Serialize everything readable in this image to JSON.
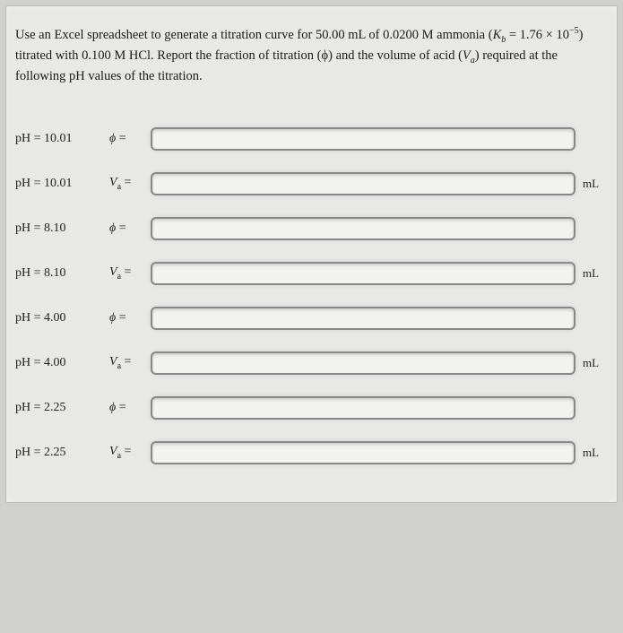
{
  "prompt": {
    "text_before_k": "Use an Excel spreadsheet to generate a titration curve for 50.00 mL of 0.0200 M ammonia (",
    "k_symbol": "K",
    "k_sub": "b",
    "k_eq": " = 1.76 × 10",
    "k_exp": "−5",
    "text_after_k": ") titrated with 0.100 M HCl. Report the fraction of titration (ϕ) and the volume of acid (",
    "va_prefix": "V",
    "va_sub": "a",
    "text_end": ") required at the following pH values of the titration."
  },
  "rows": [
    {
      "label": "pH = 10.01",
      "symbol_txt": "ϕ =",
      "symbol_html": "phi",
      "unit": ""
    },
    {
      "label": "pH = 10.01",
      "symbol_txt": "Vₐ =",
      "symbol_html": "va",
      "unit": "mL"
    },
    {
      "label": "pH = 8.10",
      "symbol_txt": "ϕ =",
      "symbol_html": "phi",
      "unit": ""
    },
    {
      "label": "pH = 8.10",
      "symbol_txt": "Vₐ =",
      "symbol_html": "va",
      "unit": "mL"
    },
    {
      "label": "pH = 4.00",
      "symbol_txt": "ϕ =",
      "symbol_html": "phi",
      "unit": ""
    },
    {
      "label": "pH = 4.00",
      "symbol_txt": "Vₐ =",
      "symbol_html": "va",
      "unit": "mL"
    },
    {
      "label": "pH = 2.25",
      "symbol_txt": "ϕ =",
      "symbol_html": "phi",
      "unit": ""
    },
    {
      "label": "pH = 2.25",
      "symbol_txt": "Vₐ =",
      "symbol_html": "va",
      "unit": "mL"
    }
  ]
}
